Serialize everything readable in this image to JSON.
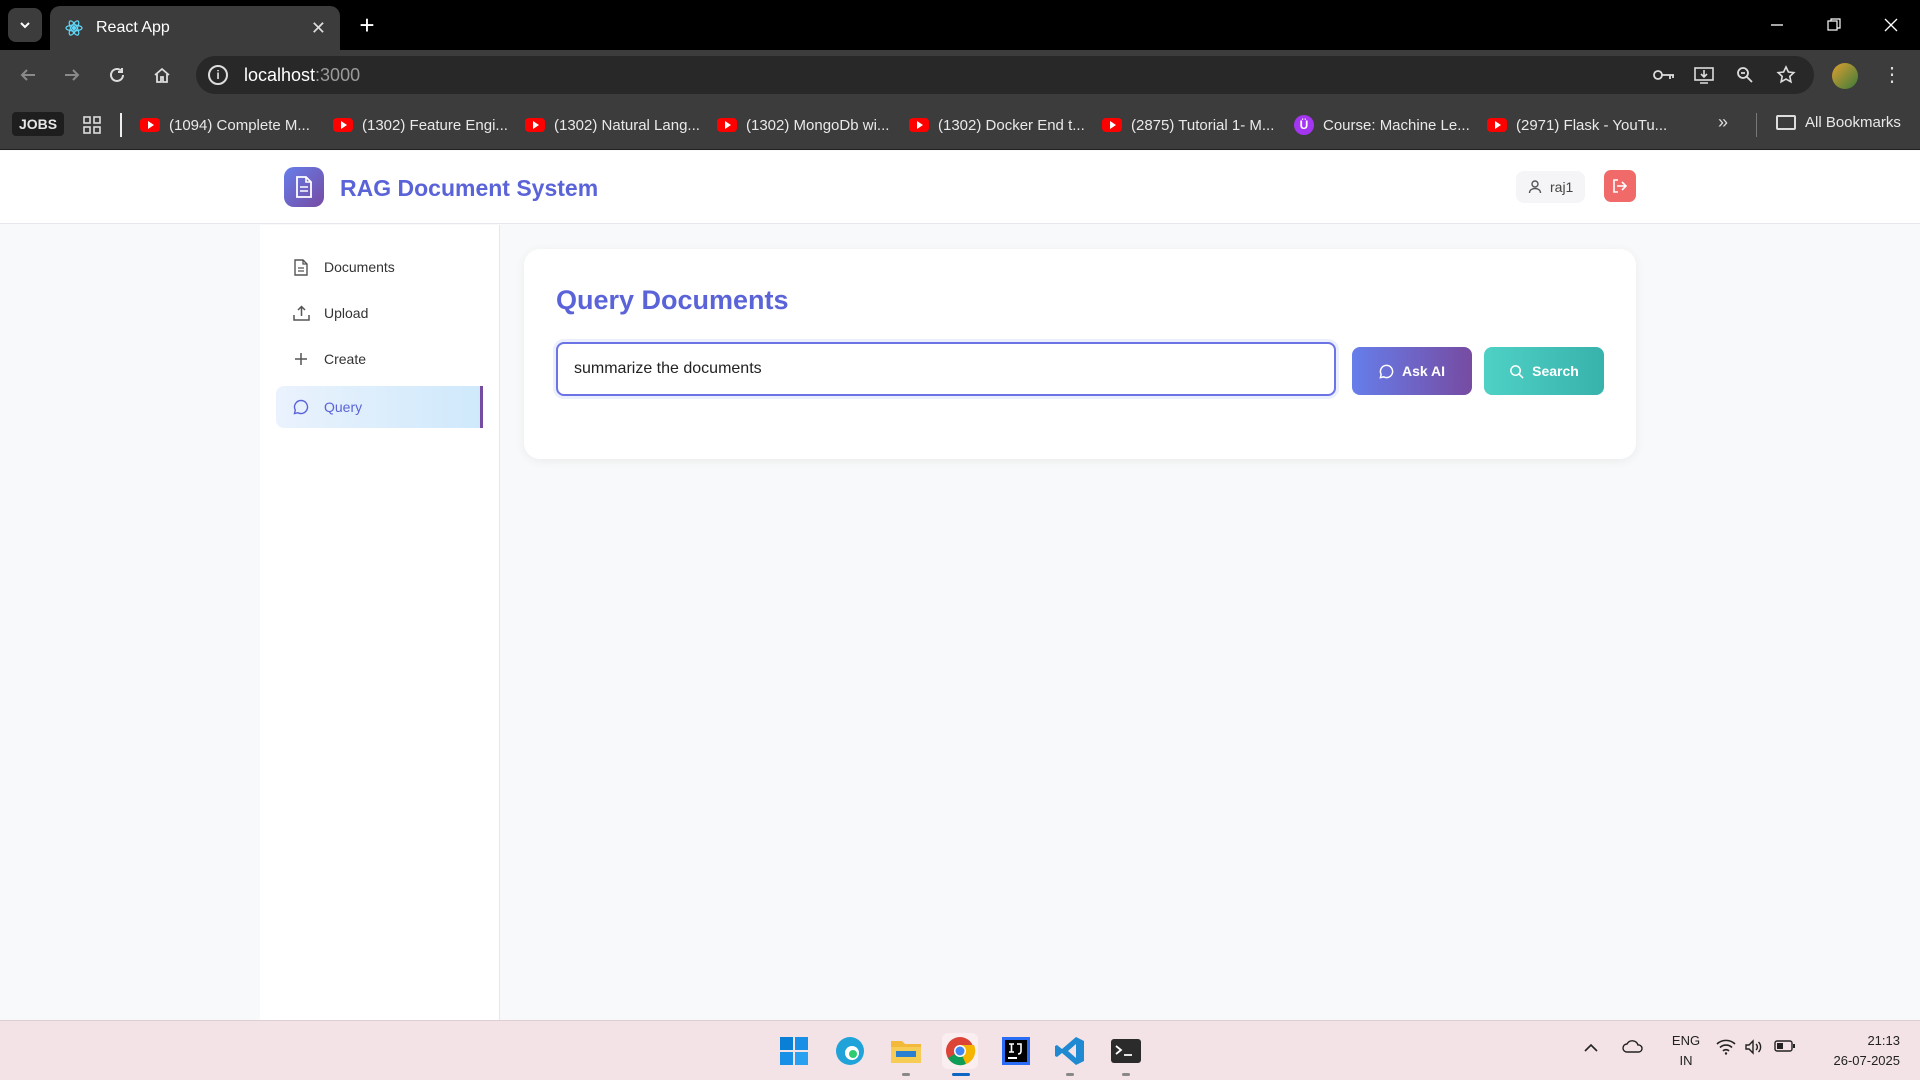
{
  "browser": {
    "tab_title": "React App",
    "url_host": "localhost",
    "url_port": ":3000",
    "bookmarks": {
      "jobs": "JOBS",
      "items": [
        "(1094) Complete M...",
        "(1302) Feature Engi...",
        "(1302) Natural Lang...",
        "(1302) MongoDb wi...",
        "(1302) Docker End t...",
        "(2875) Tutorial 1- M...",
        "Course: Machine Le...",
        "(2971) Flask - YouTu..."
      ],
      "all": "All Bookmarks"
    }
  },
  "app": {
    "title": "RAG Document System",
    "user": "raj1",
    "brand_color": "#5a63d8"
  },
  "sidebar": {
    "items": [
      {
        "label": "Documents",
        "icon": "document-icon"
      },
      {
        "label": "Upload",
        "icon": "upload-icon"
      },
      {
        "label": "Create",
        "icon": "plus-icon"
      },
      {
        "label": "Query",
        "icon": "chat-icon",
        "active": true
      }
    ]
  },
  "query": {
    "title": "Query Documents",
    "input_value": "summarize the documents",
    "ask_label": "Ask AI",
    "search_label": "Search"
  },
  "taskbar": {
    "lang_top": "ENG",
    "lang_bottom": "IN",
    "time": "21:13",
    "date": "26-07-2025"
  }
}
